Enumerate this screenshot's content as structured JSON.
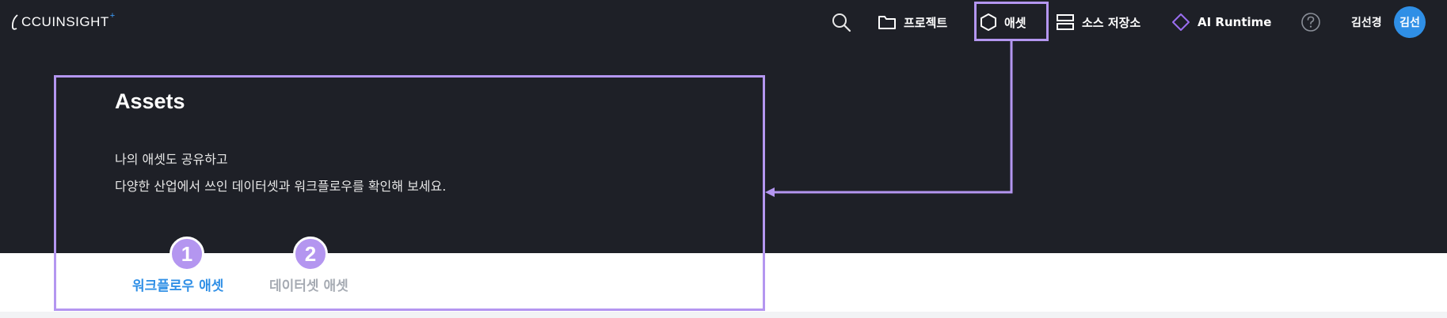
{
  "header": {
    "logo_text": "CCUINSIGHT",
    "logo_plus": "+",
    "nav": {
      "projects_label": "프로젝트",
      "assets_label": "애셋",
      "source_repo_label": "소스 저장소",
      "ai_runtime_label": "AI Runtime"
    },
    "user": {
      "name": "김선경",
      "avatar_text": "김선"
    }
  },
  "hero": {
    "title": "Assets",
    "description_line1": "나의 애셋도 공유하고",
    "description_line2": "다양한 산업에서 쓰인 데이터셋과 워크플로우를 확인해 보세요."
  },
  "tabs": {
    "workflow_label": "워크플로우 애셋",
    "dataset_label": "데이터셋 애셋"
  },
  "annotations": {
    "badge1": "1",
    "badge2": "2"
  },
  "colors": {
    "background": "#1e2027",
    "highlight": "#b496f0",
    "active_tab": "#2f8fe6",
    "inactive_tab": "#a6abb3",
    "avatar": "#2f8fe6",
    "ai_runtime_icon": "#9a6df0"
  },
  "icons": [
    "search-icon",
    "folder-icon",
    "hexagon-icon",
    "server-icon",
    "diamond-icon",
    "help-icon"
  ]
}
